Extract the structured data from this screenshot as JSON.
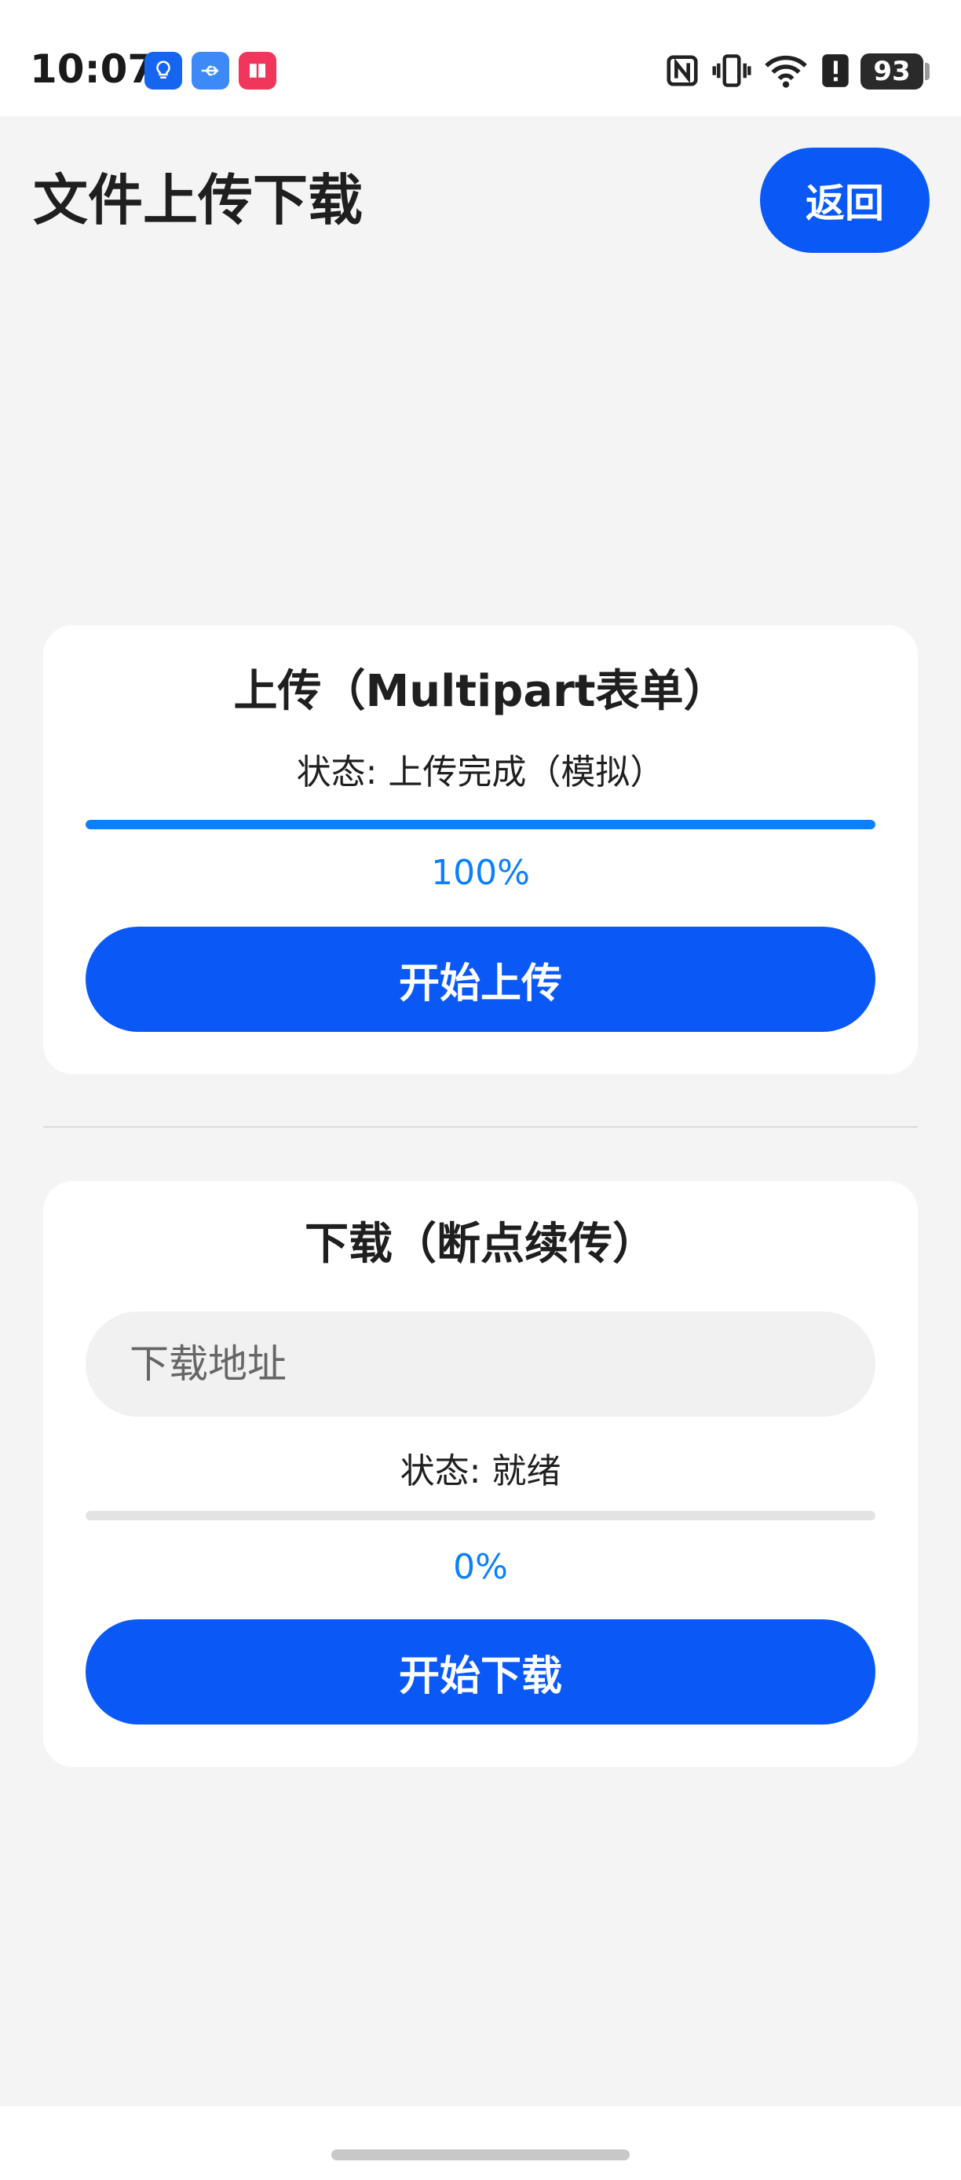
{
  "status_bar": {
    "time": "10:07",
    "battery": "93",
    "left_icons": [
      "bulb-icon",
      "usb-icon",
      "book-icon"
    ],
    "right_icons": [
      "nfc-icon",
      "vibrate-icon",
      "wifi-icon",
      "alert-icon",
      "battery-icon"
    ],
    "colors": {
      "bulb": "#1565f0",
      "usb": "#3d8af7",
      "book": "#f0365a"
    }
  },
  "header": {
    "title": "文件上传下载",
    "back_label": "返回"
  },
  "upload": {
    "title": "上传（Multipart表单）",
    "status": "状态: 上传完成（模拟）",
    "progress_percent": 100,
    "percent_label": "100%",
    "button_label": "开始上传"
  },
  "download": {
    "title": "下载（断点续传）",
    "url_placeholder": "下载地址",
    "url_value": "",
    "status": "状态: 就绪",
    "progress_percent": 0,
    "percent_label": "0%",
    "button_label": "开始下载"
  },
  "theme": {
    "accent": "#0a59f7",
    "progress": "#0a80ff",
    "background": "#f4f4f4",
    "card": "#ffffff"
  }
}
